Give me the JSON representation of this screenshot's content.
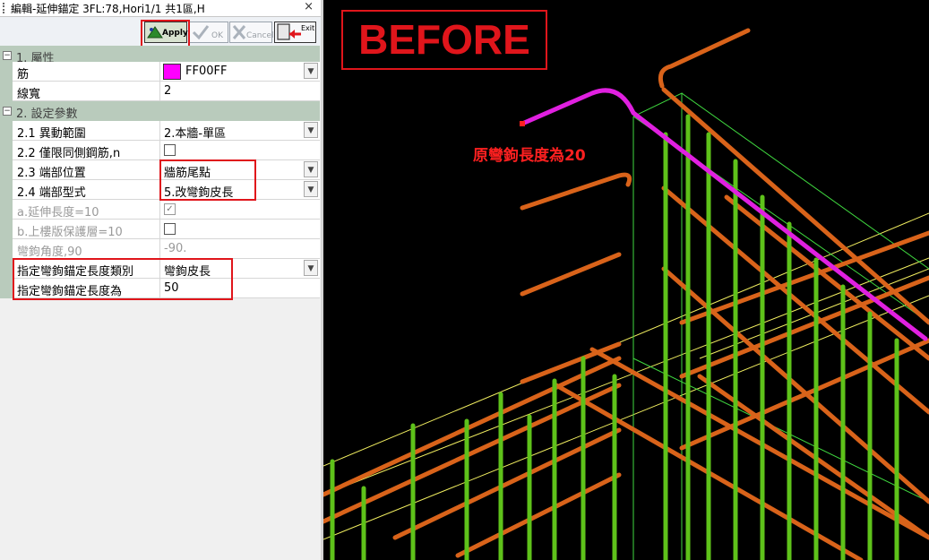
{
  "window": {
    "title": "編輯-延伸錨定 3FL:78,Hori1/1 共1區,H",
    "close_glyph": "×"
  },
  "toolbar": {
    "apply": "Apply",
    "ok": "OK",
    "cancel": "Cancel",
    "exit": "Exit"
  },
  "sections": [
    {
      "label": "1. 屬性",
      "expander": "−"
    },
    {
      "label": "2. 設定參數",
      "expander": "−"
    }
  ],
  "props": {
    "rebar": {
      "name": "筋",
      "value": "FF00FF",
      "swatch_color": "#ff00ff"
    },
    "line_width": {
      "name": "線寬",
      "value": "2"
    },
    "change_range": {
      "name": "2.1 異動範圍",
      "value": "2.本牆-單區"
    },
    "same_side": {
      "name": "2.2 僅限同側鋼筋,n",
      "checked": false
    },
    "end_position": {
      "name": "2.3 端部位置",
      "value": "牆筋尾點"
    },
    "end_type": {
      "name": "2.4 端部型式",
      "value": "5.改彎鉤皮長"
    },
    "extend_length": {
      "name": "a.延伸長度=10",
      "checked": true
    },
    "slab_cover": {
      "name": "b.上樓版保護層=10",
      "checked": false
    },
    "hook_angle": {
      "name": "彎鉤角度,90",
      "value": "-90."
    },
    "anchor_type": {
      "name": "指定彎鉤錨定長度類別",
      "value": "彎鉤皮長"
    },
    "anchor_length": {
      "name": "指定彎鉤錨定長度為",
      "value": "50"
    }
  },
  "scene": {
    "badge": "BEFORE",
    "annotation": "原彎鉤長度為20",
    "colors": {
      "background": "#000000",
      "green_bar": "#5ec21a",
      "orange_bar": "#d9631a",
      "highlight_bar": "#e020e0",
      "annotation": "#ff2020"
    }
  }
}
